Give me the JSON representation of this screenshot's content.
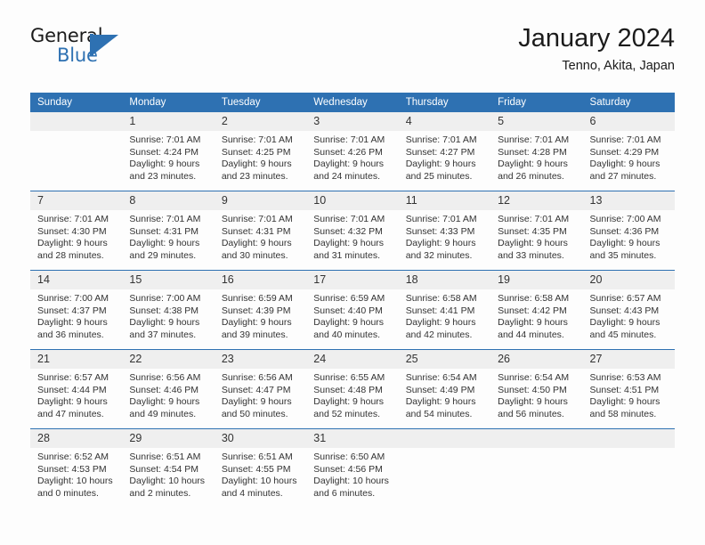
{
  "brand": {
    "name_part1": "General",
    "name_part2": "Blue",
    "mark_icon": "triangle-logo-icon"
  },
  "header": {
    "title": "January 2024",
    "subtitle": "Tenno, Akita, Japan"
  },
  "calendar": {
    "weekday_headers": [
      "Sunday",
      "Monday",
      "Tuesday",
      "Wednesday",
      "Thursday",
      "Friday",
      "Saturday"
    ],
    "accent_color": "#2e71b2",
    "day_strip_color": "#efefef",
    "weeks": [
      [
        {
          "day": "",
          "sunrise": "",
          "sunset": "",
          "daylight_line1": "",
          "daylight_line2": ""
        },
        {
          "day": "1",
          "sunrise": "Sunrise: 7:01 AM",
          "sunset": "Sunset: 4:24 PM",
          "daylight_line1": "Daylight: 9 hours",
          "daylight_line2": "and 23 minutes."
        },
        {
          "day": "2",
          "sunrise": "Sunrise: 7:01 AM",
          "sunset": "Sunset: 4:25 PM",
          "daylight_line1": "Daylight: 9 hours",
          "daylight_line2": "and 23 minutes."
        },
        {
          "day": "3",
          "sunrise": "Sunrise: 7:01 AM",
          "sunset": "Sunset: 4:26 PM",
          "daylight_line1": "Daylight: 9 hours",
          "daylight_line2": "and 24 minutes."
        },
        {
          "day": "4",
          "sunrise": "Sunrise: 7:01 AM",
          "sunset": "Sunset: 4:27 PM",
          "daylight_line1": "Daylight: 9 hours",
          "daylight_line2": "and 25 minutes."
        },
        {
          "day": "5",
          "sunrise": "Sunrise: 7:01 AM",
          "sunset": "Sunset: 4:28 PM",
          "daylight_line1": "Daylight: 9 hours",
          "daylight_line2": "and 26 minutes."
        },
        {
          "day": "6",
          "sunrise": "Sunrise: 7:01 AM",
          "sunset": "Sunset: 4:29 PM",
          "daylight_line1": "Daylight: 9 hours",
          "daylight_line2": "and 27 minutes."
        }
      ],
      [
        {
          "day": "7",
          "sunrise": "Sunrise: 7:01 AM",
          "sunset": "Sunset: 4:30 PM",
          "daylight_line1": "Daylight: 9 hours",
          "daylight_line2": "and 28 minutes."
        },
        {
          "day": "8",
          "sunrise": "Sunrise: 7:01 AM",
          "sunset": "Sunset: 4:31 PM",
          "daylight_line1": "Daylight: 9 hours",
          "daylight_line2": "and 29 minutes."
        },
        {
          "day": "9",
          "sunrise": "Sunrise: 7:01 AM",
          "sunset": "Sunset: 4:31 PM",
          "daylight_line1": "Daylight: 9 hours",
          "daylight_line2": "and 30 minutes."
        },
        {
          "day": "10",
          "sunrise": "Sunrise: 7:01 AM",
          "sunset": "Sunset: 4:32 PM",
          "daylight_line1": "Daylight: 9 hours",
          "daylight_line2": "and 31 minutes."
        },
        {
          "day": "11",
          "sunrise": "Sunrise: 7:01 AM",
          "sunset": "Sunset: 4:33 PM",
          "daylight_line1": "Daylight: 9 hours",
          "daylight_line2": "and 32 minutes."
        },
        {
          "day": "12",
          "sunrise": "Sunrise: 7:01 AM",
          "sunset": "Sunset: 4:35 PM",
          "daylight_line1": "Daylight: 9 hours",
          "daylight_line2": "and 33 minutes."
        },
        {
          "day": "13",
          "sunrise": "Sunrise: 7:00 AM",
          "sunset": "Sunset: 4:36 PM",
          "daylight_line1": "Daylight: 9 hours",
          "daylight_line2": "and 35 minutes."
        }
      ],
      [
        {
          "day": "14",
          "sunrise": "Sunrise: 7:00 AM",
          "sunset": "Sunset: 4:37 PM",
          "daylight_line1": "Daylight: 9 hours",
          "daylight_line2": "and 36 minutes."
        },
        {
          "day": "15",
          "sunrise": "Sunrise: 7:00 AM",
          "sunset": "Sunset: 4:38 PM",
          "daylight_line1": "Daylight: 9 hours",
          "daylight_line2": "and 37 minutes."
        },
        {
          "day": "16",
          "sunrise": "Sunrise: 6:59 AM",
          "sunset": "Sunset: 4:39 PM",
          "daylight_line1": "Daylight: 9 hours",
          "daylight_line2": "and 39 minutes."
        },
        {
          "day": "17",
          "sunrise": "Sunrise: 6:59 AM",
          "sunset": "Sunset: 4:40 PM",
          "daylight_line1": "Daylight: 9 hours",
          "daylight_line2": "and 40 minutes."
        },
        {
          "day": "18",
          "sunrise": "Sunrise: 6:58 AM",
          "sunset": "Sunset: 4:41 PM",
          "daylight_line1": "Daylight: 9 hours",
          "daylight_line2": "and 42 minutes."
        },
        {
          "day": "19",
          "sunrise": "Sunrise: 6:58 AM",
          "sunset": "Sunset: 4:42 PM",
          "daylight_line1": "Daylight: 9 hours",
          "daylight_line2": "and 44 minutes."
        },
        {
          "day": "20",
          "sunrise": "Sunrise: 6:57 AM",
          "sunset": "Sunset: 4:43 PM",
          "daylight_line1": "Daylight: 9 hours",
          "daylight_line2": "and 45 minutes."
        }
      ],
      [
        {
          "day": "21",
          "sunrise": "Sunrise: 6:57 AM",
          "sunset": "Sunset: 4:44 PM",
          "daylight_line1": "Daylight: 9 hours",
          "daylight_line2": "and 47 minutes."
        },
        {
          "day": "22",
          "sunrise": "Sunrise: 6:56 AM",
          "sunset": "Sunset: 4:46 PM",
          "daylight_line1": "Daylight: 9 hours",
          "daylight_line2": "and 49 minutes."
        },
        {
          "day": "23",
          "sunrise": "Sunrise: 6:56 AM",
          "sunset": "Sunset: 4:47 PM",
          "daylight_line1": "Daylight: 9 hours",
          "daylight_line2": "and 50 minutes."
        },
        {
          "day": "24",
          "sunrise": "Sunrise: 6:55 AM",
          "sunset": "Sunset: 4:48 PM",
          "daylight_line1": "Daylight: 9 hours",
          "daylight_line2": "and 52 minutes."
        },
        {
          "day": "25",
          "sunrise": "Sunrise: 6:54 AM",
          "sunset": "Sunset: 4:49 PM",
          "daylight_line1": "Daylight: 9 hours",
          "daylight_line2": "and 54 minutes."
        },
        {
          "day": "26",
          "sunrise": "Sunrise: 6:54 AM",
          "sunset": "Sunset: 4:50 PM",
          "daylight_line1": "Daylight: 9 hours",
          "daylight_line2": "and 56 minutes."
        },
        {
          "day": "27",
          "sunrise": "Sunrise: 6:53 AM",
          "sunset": "Sunset: 4:51 PM",
          "daylight_line1": "Daylight: 9 hours",
          "daylight_line2": "and 58 minutes."
        }
      ],
      [
        {
          "day": "28",
          "sunrise": "Sunrise: 6:52 AM",
          "sunset": "Sunset: 4:53 PM",
          "daylight_line1": "Daylight: 10 hours",
          "daylight_line2": "and 0 minutes."
        },
        {
          "day": "29",
          "sunrise": "Sunrise: 6:51 AM",
          "sunset": "Sunset: 4:54 PM",
          "daylight_line1": "Daylight: 10 hours",
          "daylight_line2": "and 2 minutes."
        },
        {
          "day": "30",
          "sunrise": "Sunrise: 6:51 AM",
          "sunset": "Sunset: 4:55 PM",
          "daylight_line1": "Daylight: 10 hours",
          "daylight_line2": "and 4 minutes."
        },
        {
          "day": "31",
          "sunrise": "Sunrise: 6:50 AM",
          "sunset": "Sunset: 4:56 PM",
          "daylight_line1": "Daylight: 10 hours",
          "daylight_line2": "and 6 minutes."
        },
        {
          "day": "",
          "sunrise": "",
          "sunset": "",
          "daylight_line1": "",
          "daylight_line2": ""
        },
        {
          "day": "",
          "sunrise": "",
          "sunset": "",
          "daylight_line1": "",
          "daylight_line2": ""
        },
        {
          "day": "",
          "sunrise": "",
          "sunset": "",
          "daylight_line1": "",
          "daylight_line2": ""
        }
      ]
    ]
  }
}
